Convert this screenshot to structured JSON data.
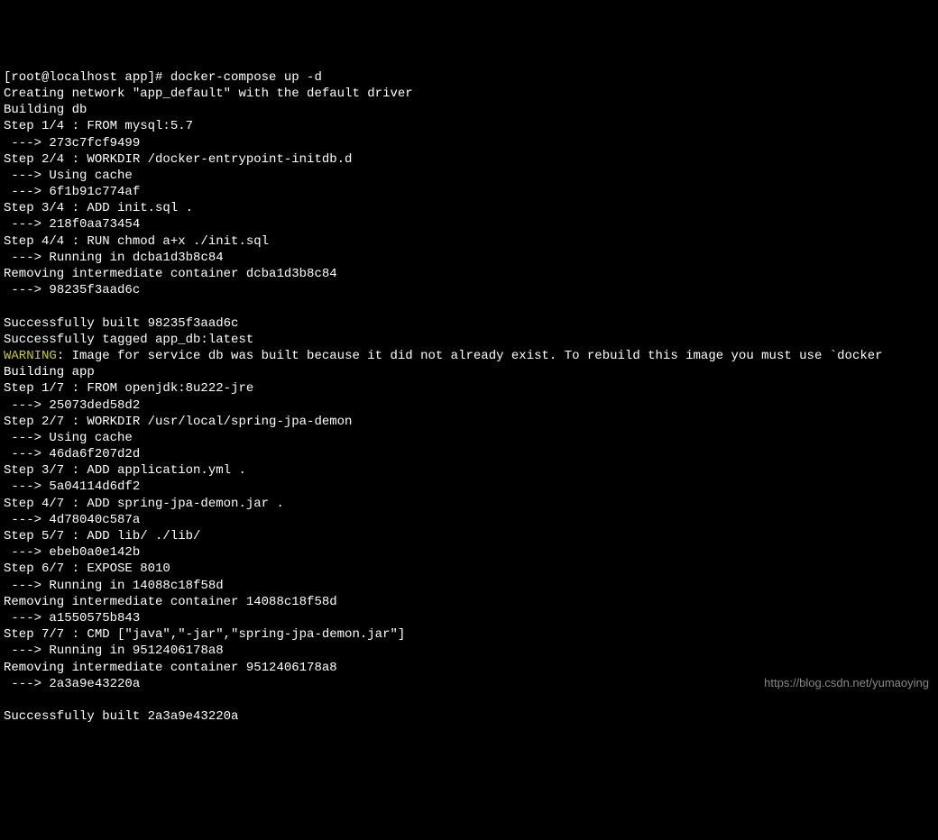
{
  "prompt": "[root@localhost app]# docker-compose up -d",
  "lines": [
    "Creating network \"app_default\" with the default driver",
    "Building db",
    "Step 1/4 : FROM mysql:5.7",
    " ---> 273c7fcf9499",
    "Step 2/4 : WORKDIR /docker-entrypoint-initdb.d",
    " ---> Using cache",
    " ---> 6f1b91c774af",
    "Step 3/4 : ADD init.sql .",
    " ---> 218f0aa73454",
    "Step 4/4 : RUN chmod a+x ./init.sql",
    " ---> Running in dcba1d3b8c84",
    "Removing intermediate container dcba1d3b8c84",
    " ---> 98235f3aad6c",
    "",
    "Successfully built 98235f3aad6c",
    "Successfully tagged app_db:latest"
  ],
  "warning_label": "WARNING",
  "warning_text": ": Image for service db was built because it did not already exist. To rebuild this image you must use `docker",
  "lines2": [
    "Building app",
    "Step 1/7 : FROM openjdk:8u222-jre",
    " ---> 25073ded58d2",
    "Step 2/7 : WORKDIR /usr/local/spring-jpa-demon",
    " ---> Using cache",
    " ---> 46da6f207d2d",
    "Step 3/7 : ADD application.yml .",
    " ---> 5a04114d6df2",
    "Step 4/7 : ADD spring-jpa-demon.jar .",
    " ---> 4d78040c587a",
    "Step 5/7 : ADD lib/ ./lib/",
    " ---> ebeb0a0e142b",
    "Step 6/7 : EXPOSE 8010",
    " ---> Running in 14088c18f58d",
    "Removing intermediate container 14088c18f58d",
    " ---> a1550575b843",
    "Step 7/7 : CMD [\"java\",\"-jar\",\"spring-jpa-demon.jar\"]",
    " ---> Running in 9512406178a8",
    "Removing intermediate container 9512406178a8",
    " ---> 2a3a9e43220a",
    "",
    "Successfully built 2a3a9e43220a"
  ],
  "watermark": "https://blog.csdn.net/yumaoying"
}
